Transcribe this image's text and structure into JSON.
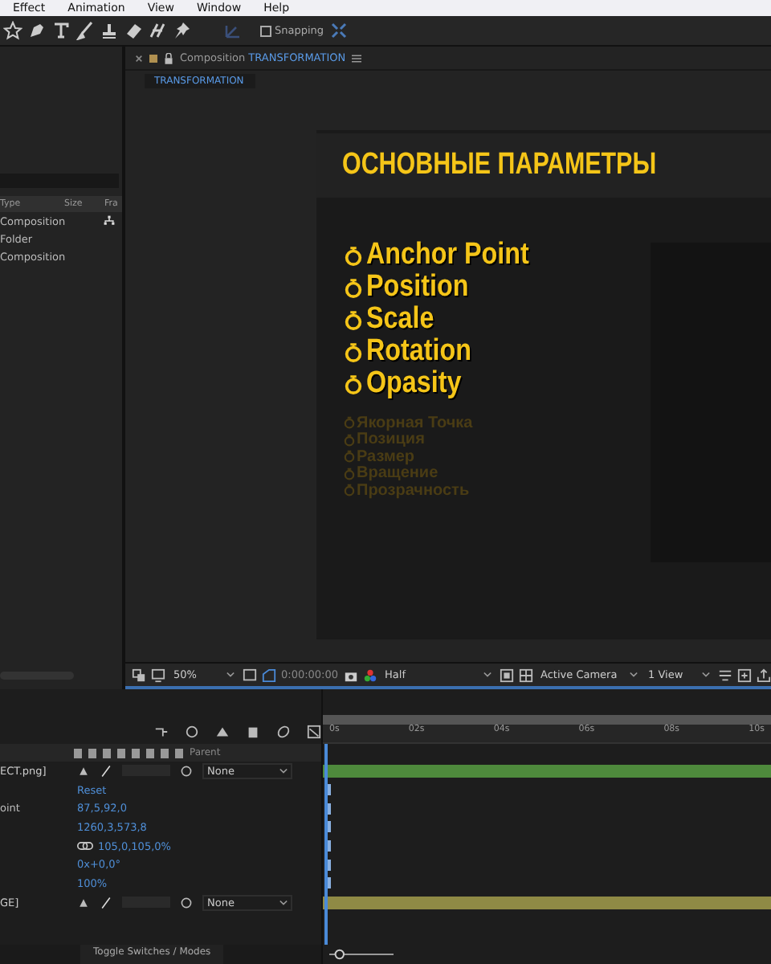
{
  "menu": [
    "Effect",
    "Animation",
    "View",
    "Window",
    "Help"
  ],
  "toolbar": {
    "snapping": {
      "label": "Snapping",
      "checked": false
    }
  },
  "project": {
    "columns": [
      "Type",
      "Size",
      "Fra"
    ],
    "rows": [
      {
        "type": "Composition",
        "selected": false,
        "linked": true
      },
      {
        "type": "Folder",
        "selected": false,
        "linked": false
      },
      {
        "type": "Composition",
        "selected": false,
        "linked": false
      }
    ]
  },
  "viewer": {
    "tab_label": "Composition",
    "tab_name": "TRANSFORMATION",
    "breadcrumb": "TRANSFORMATION",
    "slide": {
      "title": "ОСНОВНЫЕ ПАРАМЕТРЫ",
      "properties": [
        "Anchor Point",
        "Position",
        "Scale",
        "Rotation",
        "Opasity"
      ],
      "translations": [
        "Якорная Точка",
        "Позиция",
        "Размер",
        "Вращение",
        "Прозрачность"
      ]
    },
    "footer": {
      "zoom": "50%",
      "timecode": "0:00:00:00",
      "resolution": "Half",
      "camera": "Active Camera",
      "views": "1 View"
    }
  },
  "timeline": {
    "parent_header": "Parent",
    "ruler": [
      "0s",
      "02s",
      "04s",
      "06s",
      "08s",
      "10s"
    ],
    "rows": [
      {
        "kind": "layer",
        "name": "ECT.png]",
        "parent": "None",
        "color": "#4e8a3c"
      },
      {
        "kind": "property",
        "label": "",
        "value": "Reset"
      },
      {
        "kind": "property",
        "label": "oint",
        "value": "87,5,92,0"
      },
      {
        "kind": "property",
        "label": "",
        "value": "1260,3,573,8"
      },
      {
        "kind": "property",
        "label": "",
        "value": "105,0,105,0%",
        "linked": true
      },
      {
        "kind": "property",
        "label": "",
        "value": "0x+0,0°"
      },
      {
        "kind": "property",
        "label": "",
        "value": "100%"
      },
      {
        "kind": "layer",
        "name": "GE]",
        "parent": "None",
        "color": "#8f8a45"
      }
    ],
    "footer": "Toggle Switches / Modes",
    "zoom": {
      "level": 0.1
    }
  }
}
